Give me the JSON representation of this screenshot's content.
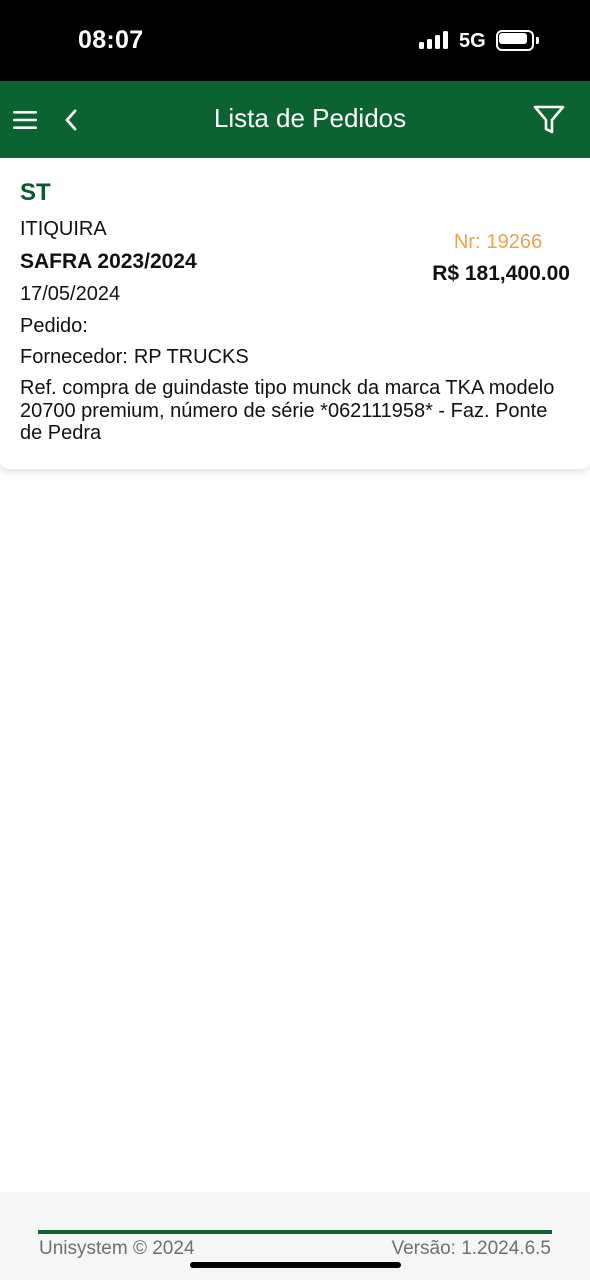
{
  "status_bar": {
    "time": "08:07",
    "network": "5G",
    "signal_icon": "cellular-signal-icon",
    "battery_icon": "battery-icon"
  },
  "header": {
    "title": "Lista de Pedidos",
    "menu_icon": "hamburger-menu-icon",
    "back_icon": "chevron-left-icon",
    "filter_icon": "filter-funnel-icon",
    "background_color": "#0a6330"
  },
  "orders": [
    {
      "name": "ST",
      "city": "ITIQUIRA",
      "safra": "SAFRA 2023/2024",
      "date": "17/05/2024",
      "pedido_label": "Pedido:",
      "fornecedor_label": "Fornecedor:",
      "fornecedor": "RP TRUCKS",
      "description": "Ref. compra de guindaste tipo munck da marca TKA modelo 20700 premium, número de série *062111958* - Faz. Ponte de Pedra",
      "nr_label": "Nr:",
      "nr": "19266",
      "value": "R$ 181,400.00",
      "name_color": "#0a5a2c",
      "nr_color": "#f0a050"
    }
  ],
  "footer": {
    "copyright": "Unisystem © 2024",
    "version": "Versão: 1.2024.6.5"
  }
}
